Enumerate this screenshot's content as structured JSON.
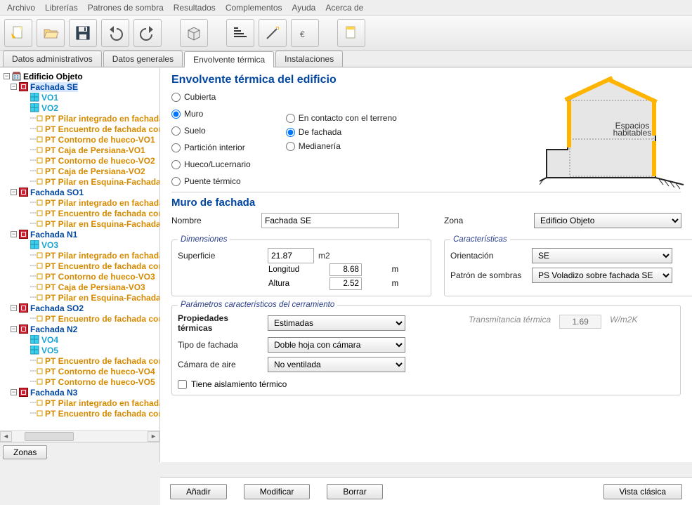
{
  "menu": [
    "Archivo",
    "Librerías",
    "Patrones de sombra",
    "Resultados",
    "Complementos",
    "Ayuda",
    "Acerca de"
  ],
  "tabs": {
    "items": [
      "Datos administrativos",
      "Datos generales",
      "Envolvente térmica",
      "Instalaciones"
    ],
    "active": 2
  },
  "tree": {
    "root": "Edificio Objeto",
    "facades": [
      {
        "name": "Fachada SE",
        "selected": true,
        "children": [
          {
            "t": "w",
            "label": "VO1"
          },
          {
            "t": "w",
            "label": "VO2"
          },
          {
            "t": "pt",
            "label": "PT Pilar integrado en fachada"
          },
          {
            "t": "pt",
            "label": "PT Encuentro de fachada con"
          },
          {
            "t": "pt",
            "label": "PT Contorno de hueco-VO1"
          },
          {
            "t": "pt",
            "label": "PT Caja de Persiana-VO1"
          },
          {
            "t": "pt",
            "label": "PT Contorno de hueco-VO2"
          },
          {
            "t": "pt",
            "label": "PT Caja de Persiana-VO2"
          },
          {
            "t": "pt",
            "label": "PT Pilar en Esquina-Fachada"
          }
        ]
      },
      {
        "name": "Fachada SO1",
        "children": [
          {
            "t": "pt",
            "label": "PT Pilar integrado en fachada"
          },
          {
            "t": "pt",
            "label": "PT Encuentro de fachada con"
          },
          {
            "t": "pt",
            "label": "PT Pilar en Esquina-Fachada"
          }
        ]
      },
      {
        "name": "Fachada N1",
        "children": [
          {
            "t": "w",
            "label": "VO3"
          },
          {
            "t": "pt",
            "label": "PT Pilar integrado en fachada"
          },
          {
            "t": "pt",
            "label": "PT Encuentro de fachada con"
          },
          {
            "t": "pt",
            "label": "PT Contorno de hueco-VO3"
          },
          {
            "t": "pt",
            "label": "PT Caja de Persiana-VO3"
          },
          {
            "t": "pt",
            "label": "PT Pilar en Esquina-Fachada"
          }
        ]
      },
      {
        "name": "Fachada SO2",
        "children": [
          {
            "t": "pt",
            "label": "PT Encuentro de fachada con"
          }
        ]
      },
      {
        "name": "Fachada N2",
        "children": [
          {
            "t": "w",
            "label": "VO4"
          },
          {
            "t": "w",
            "label": "VO5"
          },
          {
            "t": "pt",
            "label": "PT Encuentro de fachada con"
          },
          {
            "t": "pt",
            "label": "PT Contorno de hueco-VO4"
          },
          {
            "t": "pt",
            "label": "PT Contorno de hueco-VO5"
          }
        ]
      },
      {
        "name": "Fachada N3",
        "children": [
          {
            "t": "pt",
            "label": "PT Pilar integrado en fachada"
          },
          {
            "t": "pt",
            "label": "PT Encuentro de fachada con"
          }
        ]
      }
    ]
  },
  "zonas_btn": "Zonas",
  "detail": {
    "title": "Envolvente térmica del edificio",
    "radios": {
      "main": [
        "Cubierta",
        "Muro",
        "Suelo",
        "Partición interior",
        "Hueco/Lucernario",
        "Puente térmico"
      ],
      "main_sel": 1,
      "sub": [
        "En contacto con el terreno",
        "De fachada",
        "Medianería"
      ],
      "sub_sel": 1
    },
    "subsection": "Muro de fachada",
    "nombre_label": "Nombre",
    "nombre_value": "Fachada SE",
    "zona_label": "Zona",
    "zona_value": "Edificio Objeto",
    "dimensiones_legend": "Dimensiones",
    "superficie_label": "Superficie",
    "superficie_value": "21.87",
    "superficie_unit": "m2",
    "longitud_label": "Longitud",
    "longitud_value": "8.68",
    "longitud_unit": "m",
    "altura_label": "Altura",
    "altura_value": "2.52",
    "altura_unit": "m",
    "caracteristicas_legend": "Características",
    "orientacion_label": "Orientación",
    "orientacion_value": "SE",
    "patron_label": "Patrón de sombras",
    "patron_value": "PS Voladizo sobre fachada SE",
    "parametros_legend": "Parámetros característicos del cerramiento",
    "prop_termicas_label": "Propiedades térmicas",
    "prop_termicas_value": "Estimadas",
    "tipo_fachada_label": "Tipo de fachada",
    "tipo_fachada_value": "Doble hoja con cámara",
    "camara_label": "Cámara de aire",
    "camara_value": "No ventilada",
    "aislamiento_label": "Tiene aislamiento térmico",
    "trans_label": "Transmitancia térmica",
    "trans_value": "1.69",
    "trans_unit": "W/m2K",
    "diagram_label": "Espacios habitables"
  },
  "buttons": {
    "anadir": "Añadir",
    "modificar": "Modificar",
    "borrar": "Borrar",
    "vista": "Vista clásica"
  }
}
